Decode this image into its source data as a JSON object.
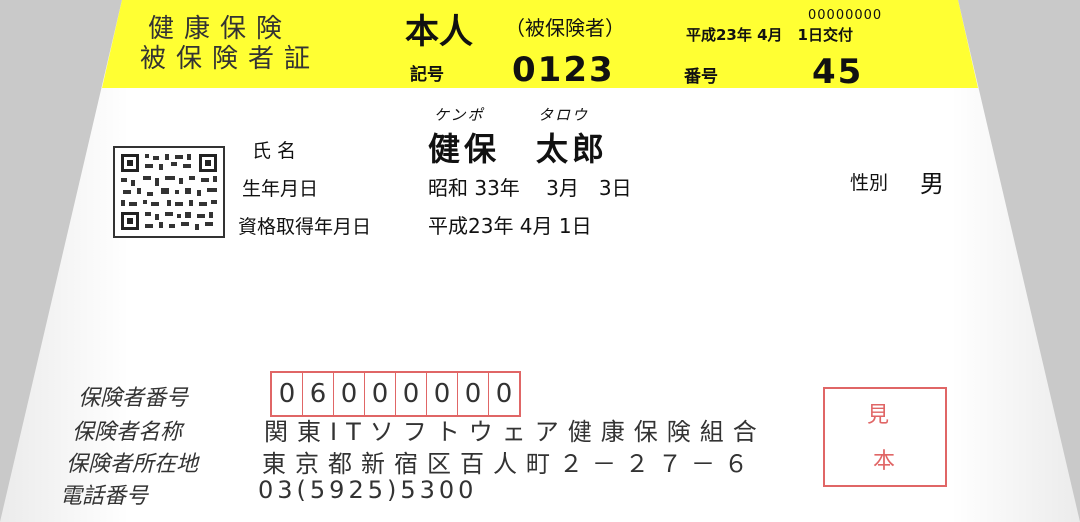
{
  "header": {
    "title_line1": "健康保険",
    "title_line2": "被保険者証",
    "holder_type": "本人",
    "holder_type_sub": "（被保険者）",
    "serial": "00000000",
    "issue_date": "平成23年 4月　1日交付",
    "kigo_label": "記号",
    "kigo_value": "0123",
    "bango_label": "番号",
    "bango_value": "45"
  },
  "person": {
    "furigana_family": "ケンポ",
    "furigana_given": "タロウ",
    "name_label": "氏 名",
    "name_value": "健保　太郎",
    "birth_label": "生年月日",
    "birth_value": "昭和 33年　 3月　3日",
    "sex_label": "性別",
    "sex_value": "男",
    "qualification_label": "資格取得年月日",
    "qualification_value": "平成23年 4月 1日"
  },
  "insurer": {
    "number_label": "保険者番号",
    "number_digits": [
      "0",
      "6",
      "0",
      "0",
      "0",
      "0",
      "0",
      "0"
    ],
    "name_label": "保険者名称",
    "name_value": "関東ITソフトウェア健康保険組合",
    "address_label": "保険者所在地",
    "address_value": "東京都新宿区百人町２－２７－６",
    "phone_label": "電話番号",
    "phone_value": "03(5925)5300"
  },
  "stamp": {
    "line1": "見",
    "line2": "本"
  },
  "colors": {
    "header": "#ffff33",
    "stamp": "#e06666"
  }
}
